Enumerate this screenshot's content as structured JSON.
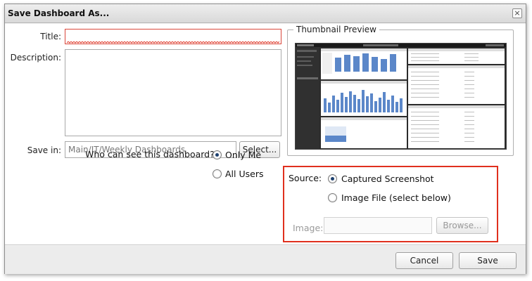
{
  "dialog": {
    "title": "Save Dashboard As...",
    "close_label": "×"
  },
  "form": {
    "title_label": "Title:",
    "title_value": "",
    "description_label": "Description:",
    "description_value": "",
    "save_in_label": "Save in:",
    "save_in_value": "Main/IT/Weekly Dashboards",
    "select_button": "Select...",
    "visibility_label": "Who can see this dashboard?:",
    "visibility_options": [
      {
        "label": "Only Me",
        "selected": true
      },
      {
        "label": "All Users",
        "selected": false
      }
    ]
  },
  "thumbnail": {
    "legend": "Thumbnail Preview"
  },
  "source": {
    "label": "Source:",
    "options": [
      {
        "label": "Captured Screenshot",
        "selected": true
      },
      {
        "label": "Image File (select below)",
        "selected": false
      }
    ],
    "image_label": "Image:",
    "image_value": "",
    "browse_button": "Browse..."
  },
  "footer": {
    "cancel_button": "Cancel",
    "save_button": "Save"
  },
  "colors": {
    "highlight_border": "#e0301e",
    "title_error_border": "#d9463a",
    "radio_dot": "#1c3f6e",
    "thumbnail_background": "#2b2b2b",
    "chart_bar": "#5b87c9"
  }
}
